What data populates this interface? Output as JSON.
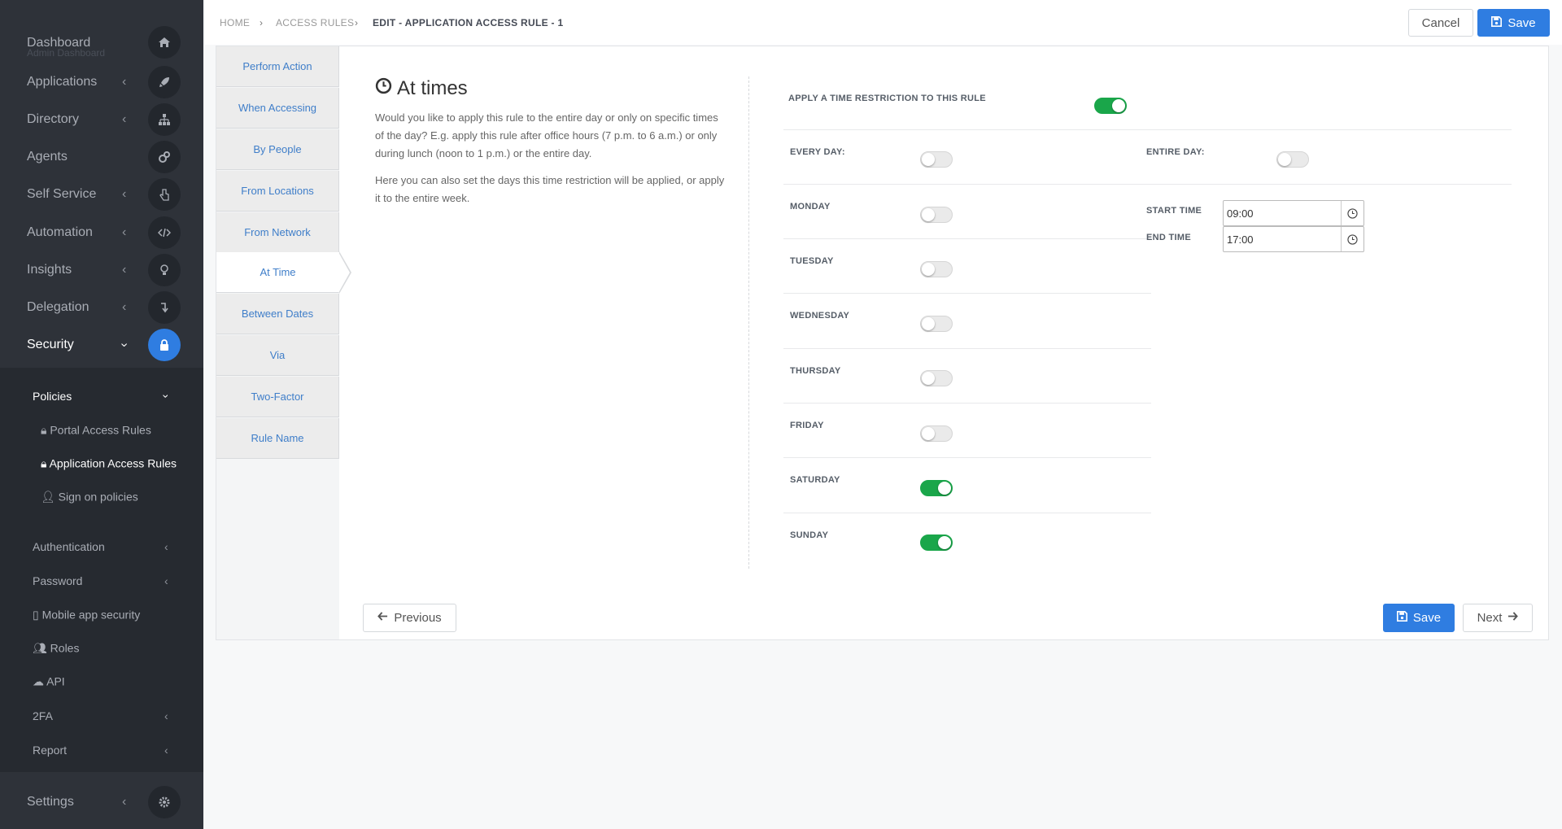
{
  "sidebar": {
    "dashboard": {
      "label": "Dashboard",
      "sub": "Admin Dashboard"
    },
    "items": [
      {
        "label": "Applications"
      },
      {
        "label": "Directory"
      },
      {
        "label": "Agents"
      },
      {
        "label": "Self Service"
      },
      {
        "label": "Automation"
      },
      {
        "label": "Insights"
      },
      {
        "label": "Delegation"
      },
      {
        "label": "Security"
      }
    ],
    "subnav": {
      "policies": "Policies",
      "portal_access_rules": "Portal Access Rules",
      "application_access_rules": "Application Access Rules",
      "sign_on_policies": "Sign on policies",
      "authentication": "Authentication",
      "password": "Password",
      "mobile_app_security": "Mobile app security",
      "roles": "Roles",
      "api": "API",
      "twofa": "2FA",
      "report": "Report"
    },
    "settings": "Settings"
  },
  "breadcrumb": {
    "home": "HOME",
    "access_rules": "ACCESS RULES",
    "current": "EDIT - APPLICATION ACCESS RULE - 1"
  },
  "toolbar": {
    "cancel": "Cancel",
    "save": "Save"
  },
  "steps": [
    "Perform Action",
    "When Accessing",
    "By People",
    "From Locations",
    "From Network",
    "At Time",
    "Between Dates",
    "Via",
    "Two-Factor",
    "Rule Name"
  ],
  "active_step": "At Time",
  "section": {
    "title": "At times",
    "desc1": "Would you like to apply this rule to the entire day or only on specific times of the day? E.g. apply this rule after office hours (7 p.m. to 6 a.m.) or only during lunch (noon to 1 p.m.) or the entire day.",
    "desc2": "Here you can also set the days this time restriction will be applied, or apply it to the entire week."
  },
  "restriction": {
    "label": "APPLY A TIME RESTRICTION TO THIS RULE",
    "on": true
  },
  "every_day": {
    "label": "EVERY DAY:",
    "on": false
  },
  "entire_day": {
    "label": "ENTIRE DAY:",
    "on": false
  },
  "days": [
    {
      "label": "MONDAY",
      "on": false
    },
    {
      "label": "TUESDAY",
      "on": false
    },
    {
      "label": "WEDNESDAY",
      "on": false
    },
    {
      "label": "THURSDAY",
      "on": false
    },
    {
      "label": "FRIDAY",
      "on": false
    },
    {
      "label": "SATURDAY",
      "on": true
    },
    {
      "label": "SUNDAY",
      "on": true
    }
  ],
  "start_time": {
    "label": "START TIME",
    "value": "09:00"
  },
  "end_time": {
    "label": "END TIME",
    "value": "17:00"
  },
  "footer": {
    "previous": "Previous",
    "save": "Save",
    "next": "Next"
  },
  "colors": {
    "accent": "#2f7de1",
    "toggle_on": "#1aa64a",
    "sidebar": "#2e3239"
  }
}
